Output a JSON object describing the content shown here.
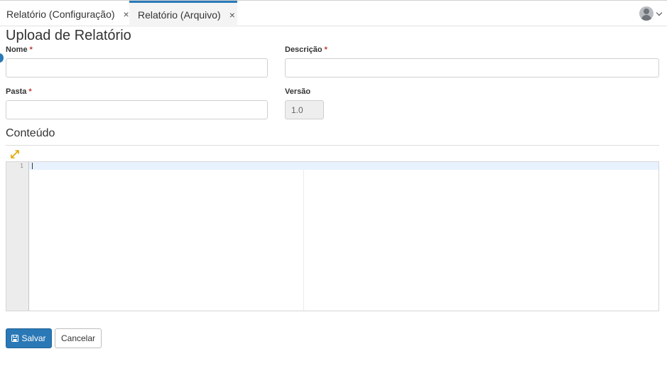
{
  "tabs": [
    {
      "label": "Relatório (Configuração)",
      "close": "×"
    },
    {
      "label": "Relatório (Arquivo)",
      "close": "×"
    }
  ],
  "user_menu": {
    "icon": "user-avatar-icon"
  },
  "form": {
    "title": "Upload de Relatório",
    "fields": {
      "nome": {
        "label": "Nome",
        "required": "*",
        "value": ""
      },
      "descricao": {
        "label": "Descrição",
        "required": "*",
        "value": ""
      },
      "pasta": {
        "label": "Pasta",
        "required": "*",
        "value": ""
      },
      "versao": {
        "label": "Versão",
        "value": "1.0"
      }
    },
    "content_section": {
      "title": "Conteúdo",
      "expand_icon": "expand-icon",
      "editor": {
        "line_numbers": [
          "1"
        ]
      }
    },
    "actions": {
      "save_label": "Salvar",
      "save_icon": "floppy-disk-icon",
      "cancel_label": "Cancelar"
    }
  },
  "colors": {
    "accent": "#2a7ab8",
    "required": "#c0392b",
    "gold_icon": "#e0a800"
  }
}
